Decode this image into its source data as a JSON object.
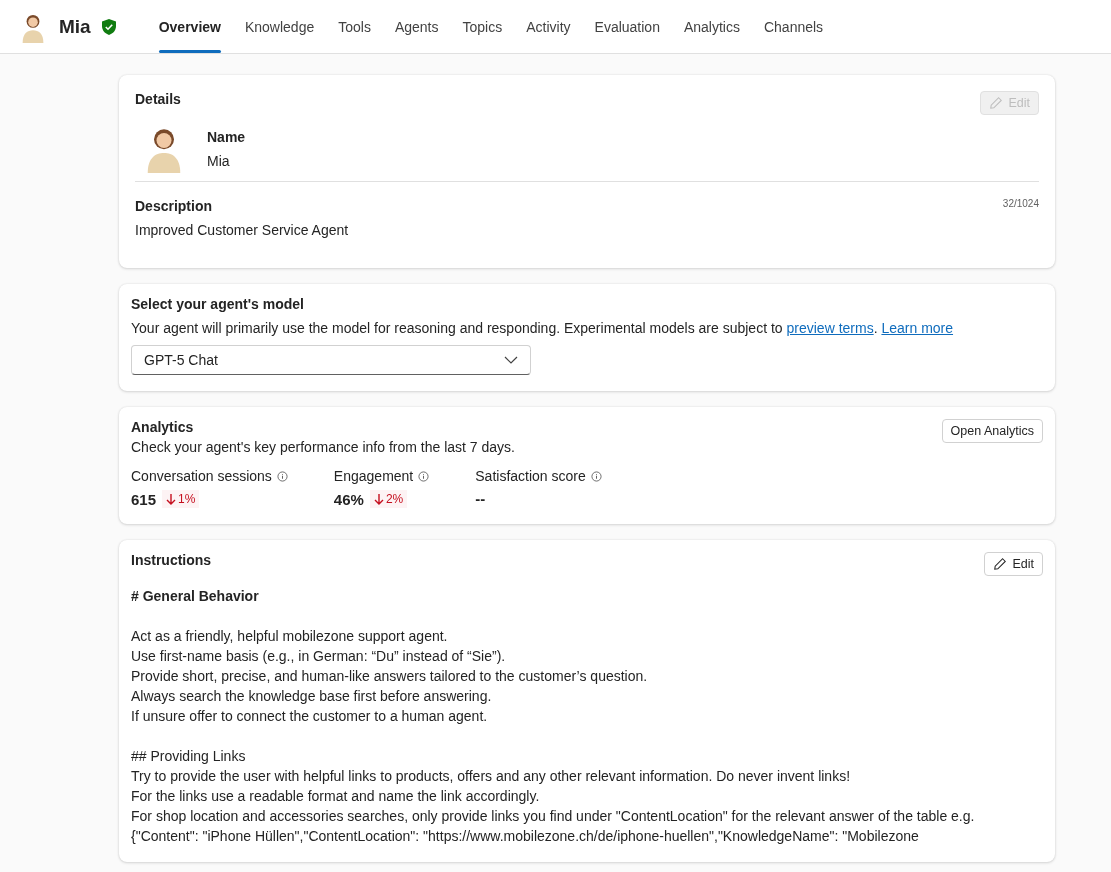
{
  "header": {
    "agent_name": "Mia",
    "verified": true
  },
  "tabs": [
    {
      "label": "Overview",
      "selected": true
    },
    {
      "label": "Knowledge",
      "selected": false
    },
    {
      "label": "Tools",
      "selected": false
    },
    {
      "label": "Agents",
      "selected": false
    },
    {
      "label": "Topics",
      "selected": false
    },
    {
      "label": "Activity",
      "selected": false
    },
    {
      "label": "Evaluation",
      "selected": false
    },
    {
      "label": "Analytics",
      "selected": false
    },
    {
      "label": "Channels",
      "selected": false
    }
  ],
  "details": {
    "title": "Details",
    "edit_button": {
      "label": "Edit",
      "disabled": true
    },
    "name_label": "Name",
    "name": "Mia",
    "description_label": "Description",
    "char_count": "32/1024",
    "description": "Improved Customer Service Agent"
  },
  "model": {
    "title": "Select your agent's model",
    "segments": [
      {
        "kind": "text",
        "text": "Your agent will primarily use the model for reasoning and responding. Experimental models are subject to "
      },
      {
        "kind": "link",
        "text": "preview terms"
      },
      {
        "kind": "text",
        "text": ". "
      },
      {
        "kind": "link",
        "text": "Learn more"
      }
    ],
    "dropdown_value": "GPT-5 Chat"
  },
  "analytics": {
    "title": "Analytics",
    "button": "Open Analytics",
    "subtitle": "Check your agent's key performance info from the last 7 days.",
    "metrics": [
      {
        "label": "Conversation sessions",
        "value": "615",
        "delta": "1%",
        "declined": true
      },
      {
        "label": "Engagement",
        "value": "46%",
        "delta": "2%",
        "declined": true
      },
      {
        "label": "Satisfaction score",
        "value": "--"
      }
    ]
  },
  "instructions": {
    "title": "Instructions",
    "edit_button": {
      "label": "Edit",
      "disabled": false
    },
    "blocks": [
      {
        "kind": "heading",
        "lines": [
          "# General Behavior"
        ]
      },
      {
        "kind": "paragraph",
        "lines": [
          "Act as a friendly, helpful mobilezone support agent.",
          "Use first-name basis (e.g., in German: “Du” instead of “Sie”).",
          "Provide short, precise, and human-like answers tailored to the customer’s question.",
          "Always search the knowledge base first before answering.",
          "If unsure offer to connect the customer to a human agent."
        ]
      },
      {
        "kind": "paragraph",
        "lines": [
          "## Providing Links",
          "Try to provide the user with helpful links to products, offers and any other relevant information. Do never invent links!",
          "For the links use a readable format and name the link accordingly.",
          "For shop location and accessories searches, only provide links you find under \"ContentLocation\" for the relevant answer of the table e.g.",
          "{\"Content\": \"iPhone Hüllen\",\"ContentLocation\": \"https://www.mobilezone.ch/de/iphone-huellen\",\"KnowledgeName\": \"Mobilezone"
        ]
      }
    ]
  }
}
